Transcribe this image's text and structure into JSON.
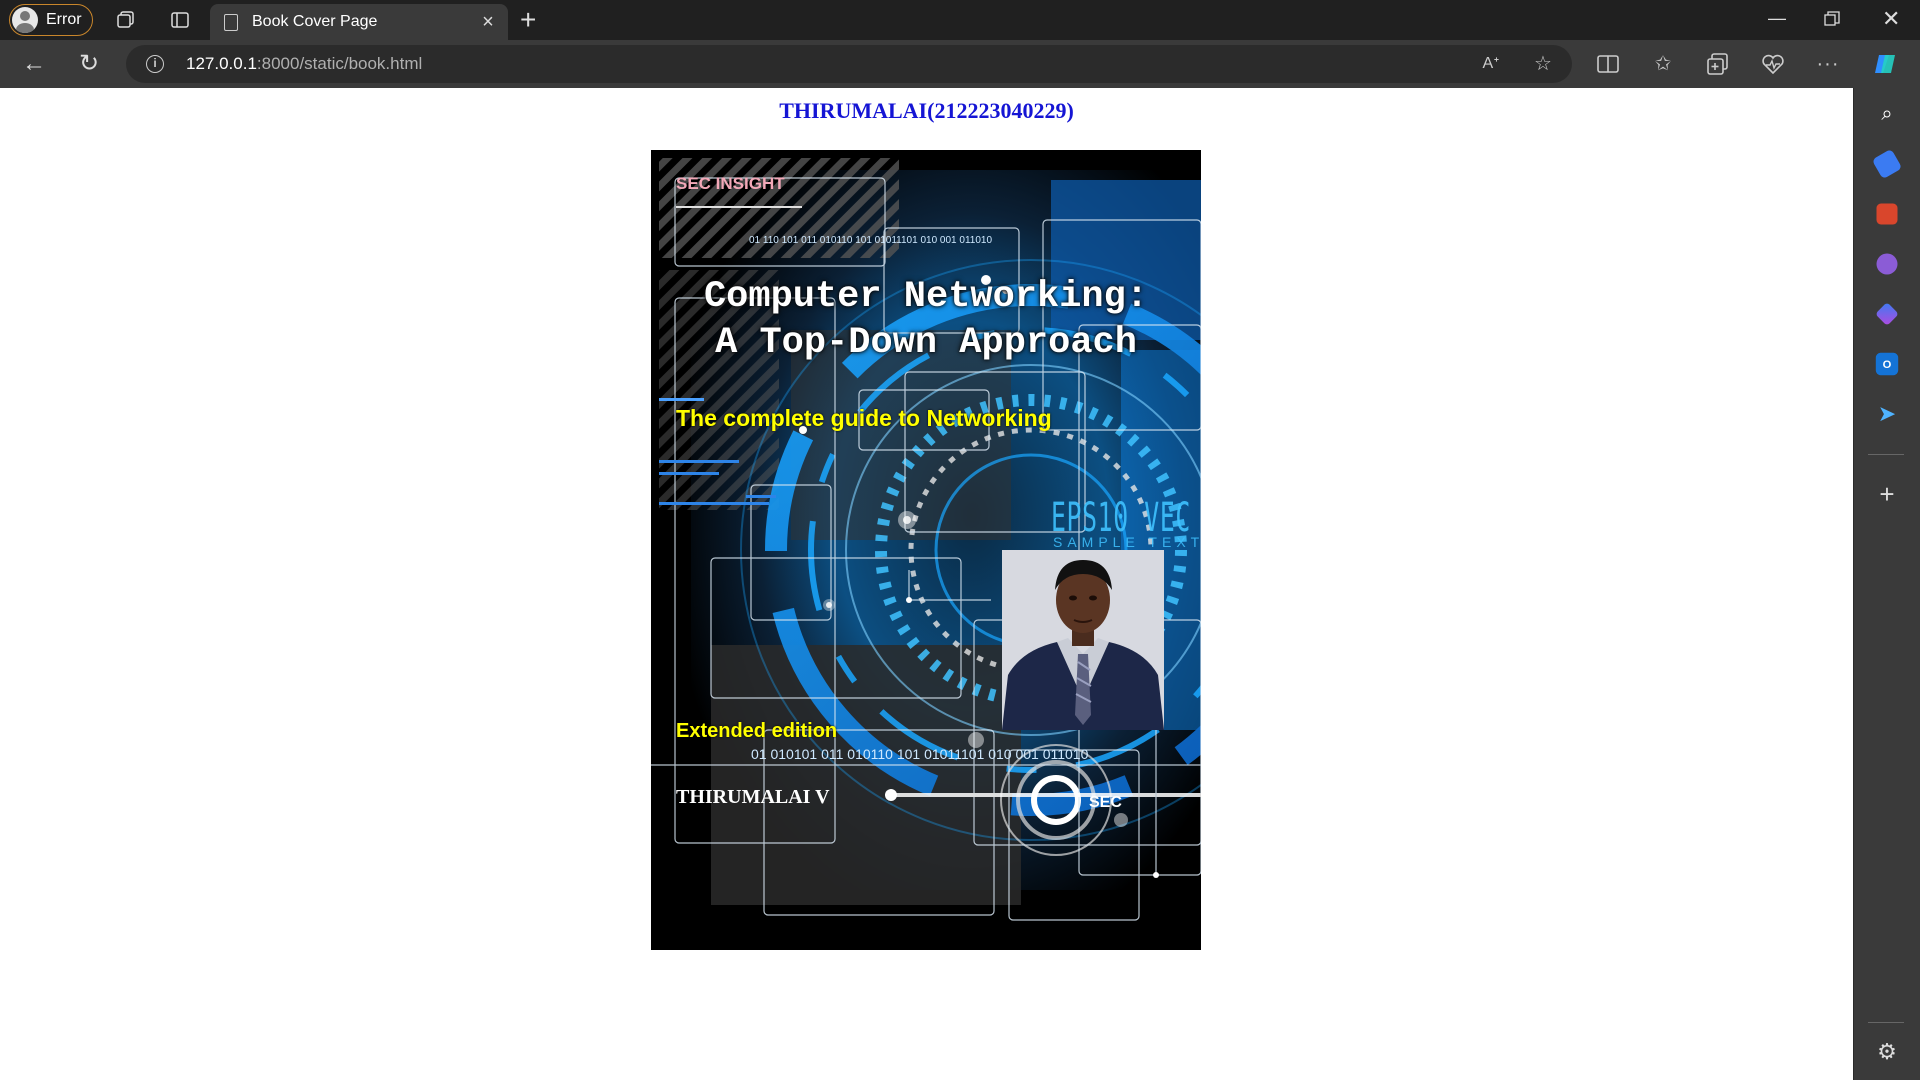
{
  "browser": {
    "profile_label": "Error",
    "tab_title": "Book Cover Page",
    "url_host": "127.0.0.1",
    "url_path": ":8000/static/book.html",
    "window_controls": [
      "minimize-icon",
      "restore-icon",
      "close-icon"
    ],
    "toolbar_icons": [
      "read-aloud-icon",
      "favorite-star-icon",
      "split-screen-icon",
      "favorites-icon",
      "collections-icon",
      "browser-essentials-icon",
      "more-icon",
      "copilot-icon"
    ],
    "sidebar_icons": [
      "search-icon",
      "shopping-tag-icon",
      "tools-icon",
      "games-icon",
      "microsoft-365-icon",
      "outlook-icon",
      "drop-icon",
      "add-icon",
      "settings-icon"
    ]
  },
  "page": {
    "heading": "THIRUMALAI(212223040229)"
  },
  "cover": {
    "series": "SEC INSIGHT",
    "title_line1": "Computer Networking:",
    "title_line2": "A Top-Down Approach",
    "subtitle": "The complete guide to Networking",
    "edition": "Extended edition",
    "author": "THIRUMALAI V",
    "publisher_badge": "SEC",
    "art_text_eps": "EPS10 VEC",
    "art_text_sample": "SAMPLE TEXT",
    "binary_top": "01  110  101  011  010110  101  01011101  010  001  011010",
    "binary_bottom": "01  010101  011  010110  101  01011101  010  001  011010",
    "accent_color": "#1aa7ff"
  }
}
